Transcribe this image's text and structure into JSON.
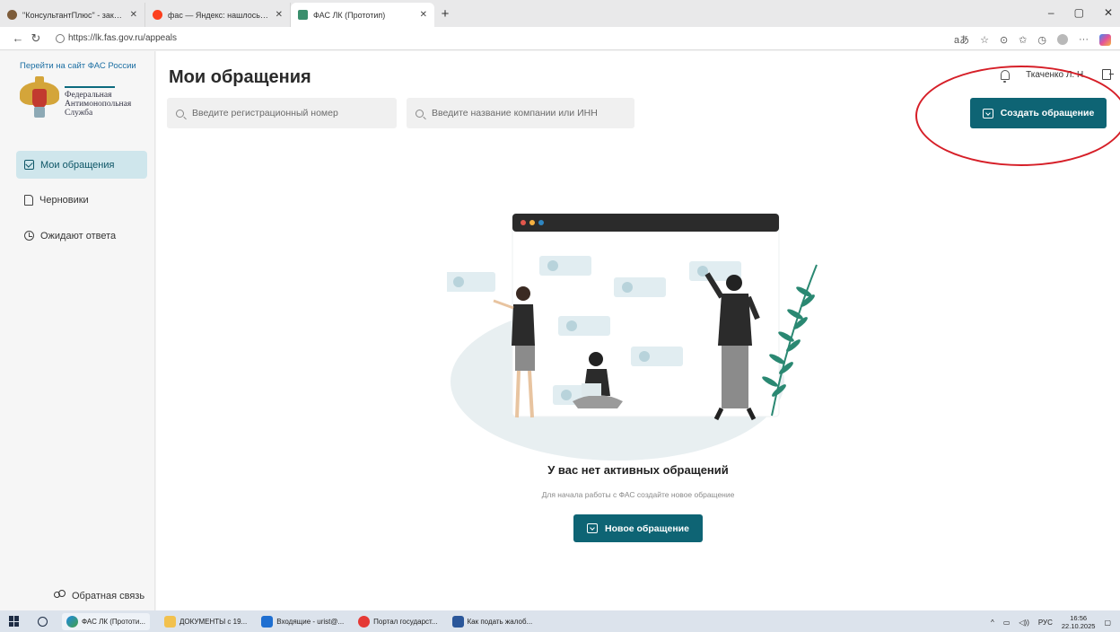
{
  "browser": {
    "tabs": [
      {
        "title": "\"КонсультантПлюс\" - законодат",
        "active": false
      },
      {
        "title": "фас — Яндекс: нашлось 12 млн",
        "active": false
      },
      {
        "title": "ФАС ЛК (Прототип)",
        "active": true
      }
    ],
    "new_tab": "+",
    "url": "https://lk.fas.gov.ru/appeals",
    "window_controls": [
      "–",
      "▢",
      "✕"
    ]
  },
  "sidebar": {
    "site_link": "Перейти на сайт ФАС России",
    "logo_lines": [
      "Федеральная",
      "Антимонопольная",
      "Служба"
    ],
    "items": [
      {
        "label": "Мои обращения",
        "icon": "mail-icon",
        "active": true
      },
      {
        "label": "Черновики",
        "icon": "document-icon",
        "active": false
      },
      {
        "label": "Ожидают ответа",
        "icon": "clock-icon",
        "active": false
      }
    ],
    "feedback": "Обратная связь"
  },
  "main": {
    "title": "Мои обращения",
    "search_reg_placeholder": "Введите регистрационный номер",
    "search_company_placeholder": "Введите название компании или ИНН",
    "user_name": "Ткаченко Л. Н.",
    "create_button": "Создать обращение",
    "empty_title": "У вас нет активных обращений",
    "empty_subtitle": "Для начала работы с ФАС создайте новое обращение",
    "new_button": "Новое обращение",
    "accent_color": "#0e6474",
    "annotation_color": "#d61f28"
  },
  "taskbar": {
    "items": [
      {
        "label": "ФАС ЛК (Прототи...",
        "active": true
      },
      {
        "label": "ДОКУМЕНТЫ с 19...",
        "active": false
      },
      {
        "label": "Входящие - urist@...",
        "active": false
      },
      {
        "label": "Портал государст...",
        "active": false
      },
      {
        "label": "Как подать жалоб...",
        "active": false
      }
    ],
    "language": "РУС",
    "time": "16:56",
    "date": "22.10.2025"
  }
}
